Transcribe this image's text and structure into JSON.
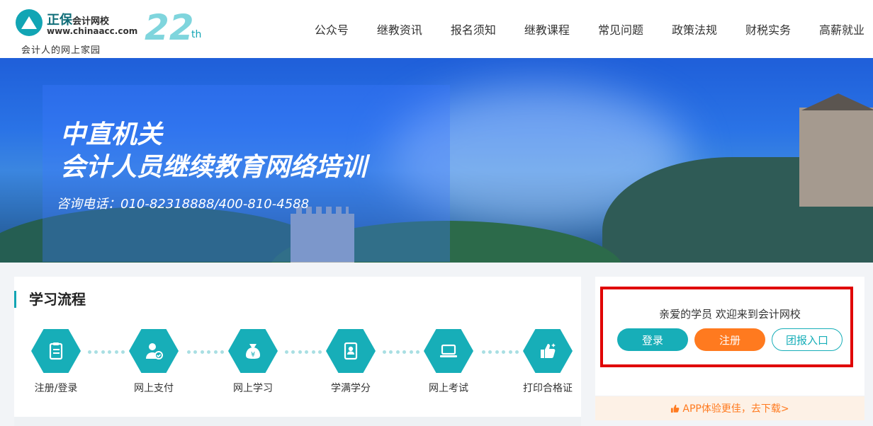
{
  "header": {
    "logo_brand": "正保",
    "logo_name": "会计网校",
    "logo_url": "www.chinaacc.com",
    "logo_slogan": "会计人的网上家园",
    "anniversary_number": "22",
    "anniversary_suffix": "th",
    "nav": [
      "公众号",
      "继教资讯",
      "报名须知",
      "继教课程",
      "常见问题",
      "政策法规",
      "财税实务",
      "高薪就业"
    ]
  },
  "banner": {
    "title_line1": "中直机关",
    "title_line2": "会计人员继续教育网络培训",
    "phone": "咨询电话：010-82318888/400-810-4588"
  },
  "study": {
    "title": "学习流程",
    "steps": [
      {
        "label": "注册/登录",
        "icon": "clipboard-icon"
      },
      {
        "label": "网上支付",
        "icon": "user-check-icon"
      },
      {
        "label": "网上学习",
        "icon": "money-bag-icon"
      },
      {
        "label": "学满学分",
        "icon": "certificate-icon"
      },
      {
        "label": "网上考试",
        "icon": "laptop-icon"
      },
      {
        "label": "打印合格证",
        "icon": "thumbs-up-icon"
      }
    ]
  },
  "account": {
    "welcome": "亲爱的学员 欢迎来到会计网校",
    "login": "登录",
    "register": "注册",
    "group": "团报入口"
  },
  "app_promo": "APP体验更佳，去下载>",
  "colors": {
    "accent": "#17aeb8",
    "orange": "#ff7a1f",
    "highlight": "#e00000"
  }
}
